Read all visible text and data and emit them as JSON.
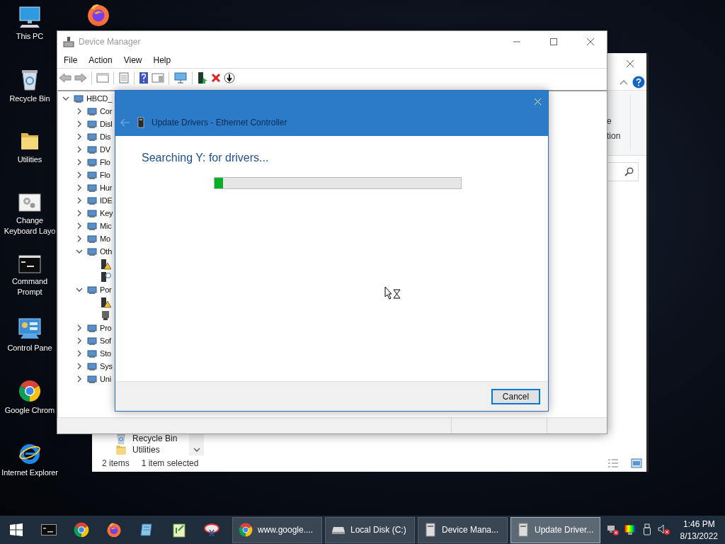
{
  "desktop": {
    "icons": [
      {
        "label": "This PC",
        "kind": "computer"
      },
      {
        "label": "Recycle Bin",
        "kind": "recycle"
      },
      {
        "label": "Utilities",
        "kind": "folder"
      },
      {
        "label": "Change Keyboard Layo",
        "kind": "settings"
      },
      {
        "label": "Command Prompt",
        "kind": "console"
      },
      {
        "label": "Control Pane",
        "kind": "control"
      },
      {
        "label": "Google Chrom",
        "kind": "chrome"
      },
      {
        "label": "Internet Explorer",
        "kind": "ie"
      }
    ]
  },
  "file_explorer": {
    "ribbon_labels": [
      "e",
      "tion"
    ],
    "nav_items": [
      {
        "label": "Recycle Bin",
        "kind": "recycle"
      },
      {
        "label": "Utilities",
        "kind": "folder"
      }
    ],
    "status": [
      "2 items",
      "1 item selected"
    ]
  },
  "device_manager": {
    "title": "Device Manager",
    "menu": [
      "File",
      "Action",
      "View",
      "Help"
    ],
    "tree": [
      {
        "label": "HBCD_",
        "expanded": true,
        "children": [
          {
            "label": "Cor",
            "expanded": false
          },
          {
            "label": "Disl",
            "expanded": false
          },
          {
            "label": "Dis",
            "expanded": false
          },
          {
            "label": "DV",
            "expanded": false
          },
          {
            "label": "Flo",
            "expanded": false
          },
          {
            "label": "Flo",
            "expanded": false
          },
          {
            "label": "Hur",
            "expanded": false
          },
          {
            "label": "IDE",
            "expanded": false
          },
          {
            "label": "Key",
            "expanded": false
          },
          {
            "label": "Mic",
            "expanded": false
          },
          {
            "label": "Mo",
            "expanded": false
          },
          {
            "label": "Oth",
            "expanded": true,
            "children": [
              {
                "kind": "warning"
              },
              {
                "kind": "unknown"
              }
            ]
          },
          {
            "label": "Por",
            "expanded": true,
            "children": [
              {
                "kind": "warning"
              },
              {
                "kind": "device"
              }
            ]
          },
          {
            "label": "Pro",
            "expanded": false
          },
          {
            "label": "Sof",
            "expanded": false
          },
          {
            "label": "Sto",
            "expanded": false
          },
          {
            "label": "Sys",
            "expanded": false
          },
          {
            "label": "Uni",
            "expanded": false
          }
        ]
      }
    ]
  },
  "dialog": {
    "title": "Update Drivers - Ethernet Controller",
    "message": "Searching Y: for drivers...",
    "progress": {
      "level": 0.035
    },
    "buttons": [
      "Cancel"
    ]
  },
  "taskbar": {
    "tasks": [
      {
        "label": "www.google....",
        "kind": "browser",
        "selected": false
      },
      {
        "label": "Local Disk (C:)",
        "kind": "drive",
        "selected": false
      },
      {
        "label": "Device Mana...",
        "kind": "device",
        "selected": false
      },
      {
        "label": "Update Driver...",
        "kind": "device",
        "selected": true
      }
    ],
    "clock": {
      "time": "1:46 PM",
      "date": "8/13/2022"
    }
  }
}
